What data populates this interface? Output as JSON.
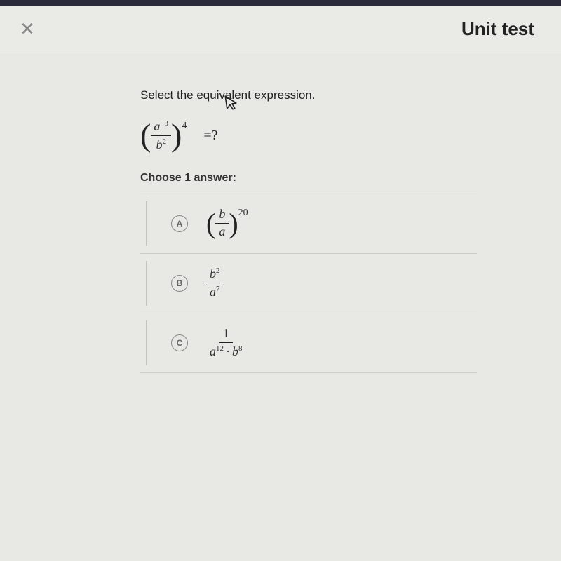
{
  "header": {
    "close_label": "✕",
    "title": "Unit test"
  },
  "question": {
    "prompt": "Select the equivalent expression.",
    "expression": {
      "numerator_base": "a",
      "numerator_exp": "−3",
      "denominator_base": "b",
      "denominator_exp": "2",
      "outer_exp": "4",
      "tail": "=?"
    },
    "choose_label": "Choose 1 answer:"
  },
  "answers": [
    {
      "badge": "A",
      "inner_num": "b",
      "inner_den": "a",
      "outer_exp": "20"
    },
    {
      "badge": "B",
      "num_base": "b",
      "num_exp": "2",
      "den_base": "a",
      "den_exp": "7"
    },
    {
      "badge": "C",
      "num_plain": "1",
      "den_a_base": "a",
      "den_a_exp": "12",
      "dot": "·",
      "den_b_base": "b",
      "den_b_exp": "8"
    }
  ]
}
